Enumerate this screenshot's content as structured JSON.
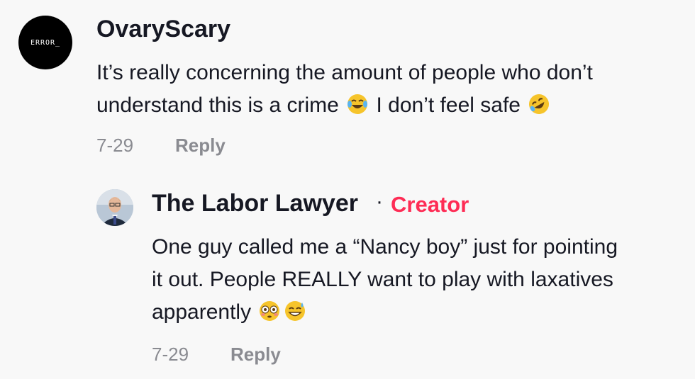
{
  "comment": {
    "avatar_text": "ERROR_",
    "username": "OvaryScary",
    "text_line1": "It’s really concerning the amount of people who don’t",
    "text_line2a": "understand this is a crime ",
    "text_line2b": " I don’t feel safe ",
    "emoji1": "face-with-tears-of-joy-icon",
    "emoji2": "rolling-on-floor-laughing-icon",
    "date": "7-29",
    "reply_label": "Reply"
  },
  "reply": {
    "username": "The Labor Lawyer",
    "separator": "·",
    "badge": "Creator",
    "text_line1": "One guy called me a “Nancy boy” just for pointing",
    "text_line2": "it out. People REALLY want to play with laxatives",
    "text_line3": "apparently ",
    "emoji1": "flushed-face-icon",
    "emoji2": "grinning-face-with-sweat-icon",
    "date": "7-29",
    "reply_label": "Reply"
  },
  "colors": {
    "background": "#f8f8f8",
    "username": "#161823",
    "creator_badge": "#fe2c55",
    "meta": "#8a8b91"
  }
}
